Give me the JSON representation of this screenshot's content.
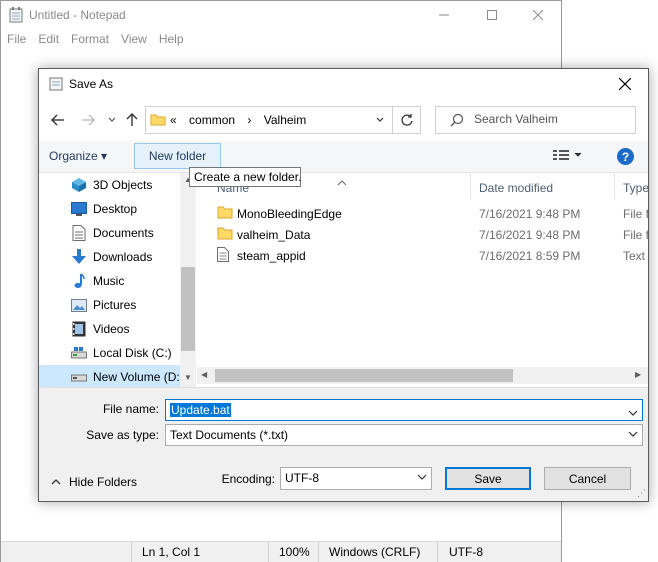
{
  "notepad": {
    "title": "Untitled - Notepad",
    "menu": [
      "File",
      "Edit",
      "Format",
      "View",
      "Help"
    ],
    "status": {
      "position": "Ln 1, Col 1",
      "zoom": "100%",
      "line_ending": "Windows (CRLF)",
      "encoding": "UTF-8"
    }
  },
  "dialog": {
    "title": "Save As",
    "address": {
      "crumbs": [
        "«",
        "common",
        "›",
        "Valheim"
      ]
    },
    "search": {
      "placeholder": "Search Valheim"
    },
    "toolbar": {
      "organize": "Organize ▾",
      "new_folder": "New folder",
      "tooltip": "Create a new folder."
    },
    "nav": [
      {
        "label": "3D Objects",
        "icon": "3d-objects-icon"
      },
      {
        "label": "Desktop",
        "icon": "desktop-icon"
      },
      {
        "label": "Documents",
        "icon": "documents-icon"
      },
      {
        "label": "Downloads",
        "icon": "downloads-icon"
      },
      {
        "label": "Music",
        "icon": "music-icon"
      },
      {
        "label": "Pictures",
        "icon": "pictures-icon"
      },
      {
        "label": "Videos",
        "icon": "videos-icon"
      },
      {
        "label": "Local Disk (C:)",
        "icon": "drive-icon"
      },
      {
        "label": "New Volume (D:",
        "icon": "drive-icon",
        "selected": true
      }
    ],
    "columns": [
      "Name",
      "Date modified",
      "Type"
    ],
    "files": [
      {
        "name": "MonoBleedingEdge",
        "date": "7/16/2021 9:48 PM",
        "type": "File fo",
        "kind": "folder"
      },
      {
        "name": "valheim_Data",
        "date": "7/16/2021 9:48 PM",
        "type": "File fo",
        "kind": "folder"
      },
      {
        "name": "steam_appid",
        "date": "7/16/2021 8:59 PM",
        "type": "Text D",
        "kind": "text"
      }
    ],
    "file_name_label": "File name:",
    "file_name_value": "Update.bat",
    "save_type_label": "Save as type:",
    "save_type_value": "Text Documents (*.txt)",
    "hide_folders": "Hide Folders",
    "encoding_label": "Encoding:",
    "encoding_value": "UTF-8",
    "save_button": "Save",
    "cancel_button": "Cancel"
  },
  "colors": {
    "accent": "#0078d7",
    "selection_bg": "#cce8ff",
    "folder": "#ffd866"
  }
}
